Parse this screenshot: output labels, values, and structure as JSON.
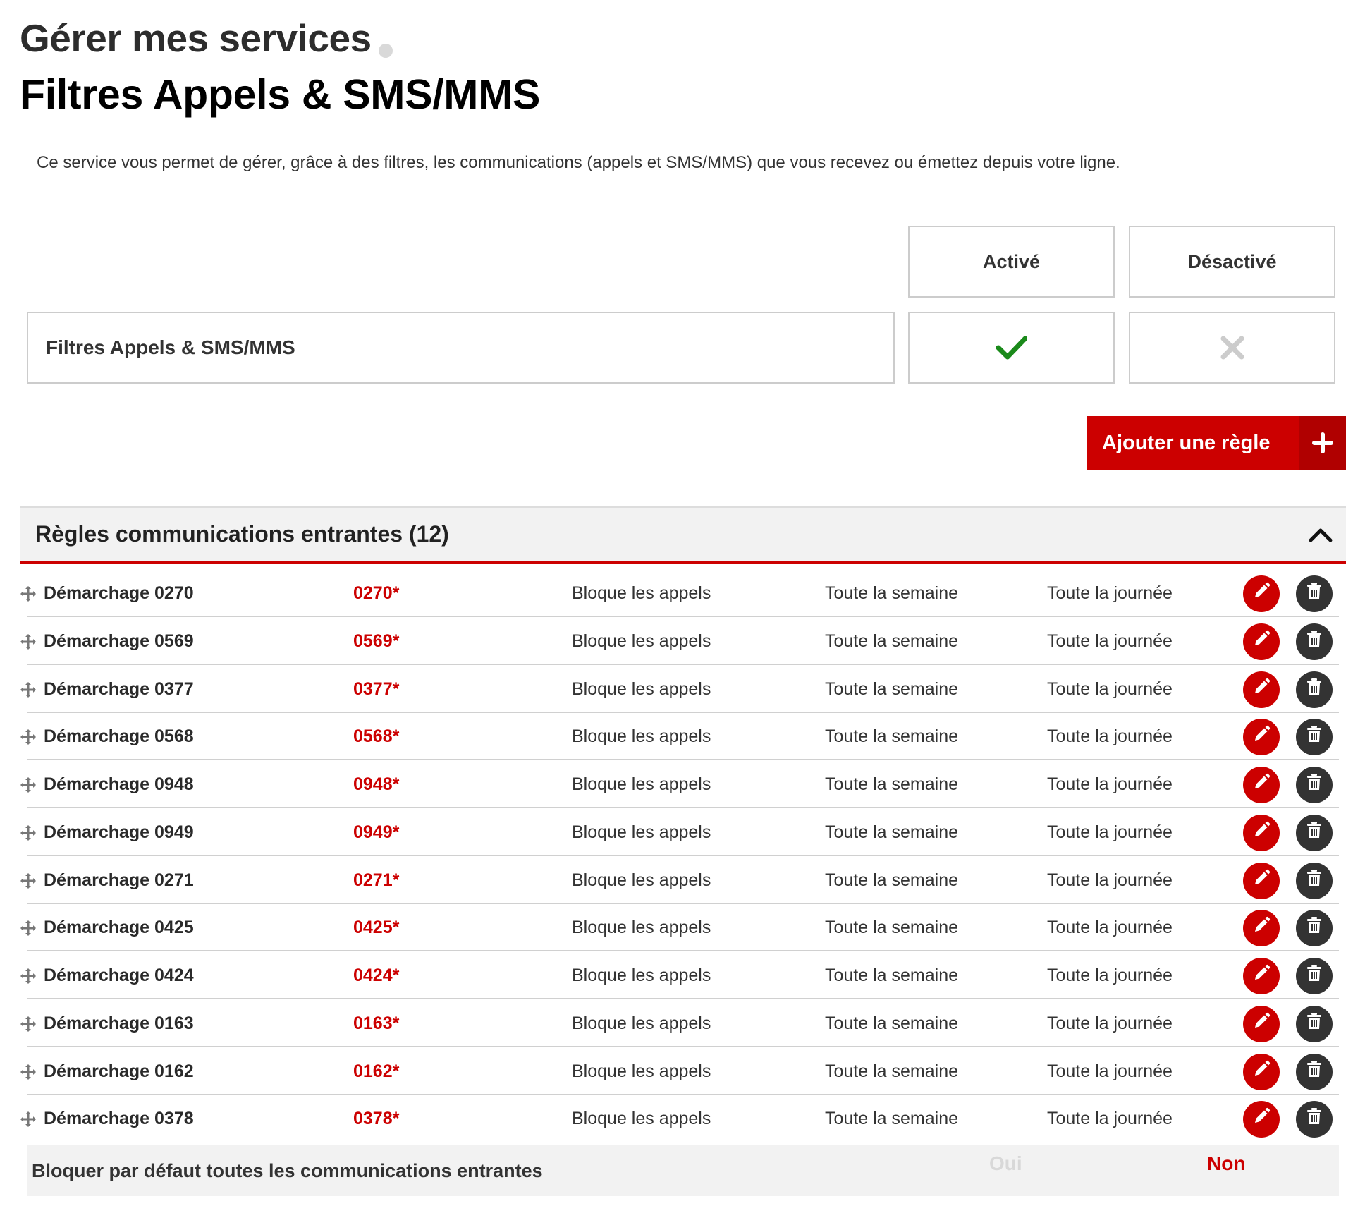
{
  "page": {
    "title": "Gérer mes services",
    "subtitle": "Filtres Appels & SMS/MMS",
    "description": "Ce service vous permet de gérer, grâce à des filtres, les communications (appels et SMS/MMS) que vous recevez ou émettez depuis votre ligne."
  },
  "status_table": {
    "col_active": "Activé",
    "col_inactive": "Désactivé",
    "service_name": "Filtres Appels & SMS/MMS",
    "active_state": "check-icon",
    "inactive_state": "cross-icon"
  },
  "add_rule": {
    "label": "Ajouter une règle"
  },
  "incoming": {
    "title": "Règles communications entrantes (12)",
    "rules": [
      {
        "name": "Démarchage 0270",
        "number": "0270*",
        "action": "Bloque les appels",
        "days": "Toute la semaine",
        "time": "Toute la journée"
      },
      {
        "name": "Démarchage 0569",
        "number": "0569*",
        "action": "Bloque les appels",
        "days": "Toute la semaine",
        "time": "Toute la journée"
      },
      {
        "name": "Démarchage 0377",
        "number": "0377*",
        "action": "Bloque les appels",
        "days": "Toute la semaine",
        "time": "Toute la journée"
      },
      {
        "name": "Démarchage 0568",
        "number": "0568*",
        "action": "Bloque les appels",
        "days": "Toute la semaine",
        "time": "Toute la journée"
      },
      {
        "name": "Démarchage 0948",
        "number": "0948*",
        "action": "Bloque les appels",
        "days": "Toute la semaine",
        "time": "Toute la journée"
      },
      {
        "name": "Démarchage 0949",
        "number": "0949*",
        "action": "Bloque les appels",
        "days": "Toute la semaine",
        "time": "Toute la journée"
      },
      {
        "name": "Démarchage 0271",
        "number": "0271*",
        "action": "Bloque les appels",
        "days": "Toute la semaine",
        "time": "Toute la journée"
      },
      {
        "name": "Démarchage 0425",
        "number": "0425*",
        "action": "Bloque les appels",
        "days": "Toute la semaine",
        "time": "Toute la journée"
      },
      {
        "name": "Démarchage 0424",
        "number": "0424*",
        "action": "Bloque les appels",
        "days": "Toute la semaine",
        "time": "Toute la journée"
      },
      {
        "name": "Démarchage 0163",
        "number": "0163*",
        "action": "Bloque les appels",
        "days": "Toute la semaine",
        "time": "Toute la journée"
      },
      {
        "name": "Démarchage 0162",
        "number": "0162*",
        "action": "Bloque les appels",
        "days": "Toute la semaine",
        "time": "Toute la journée"
      },
      {
        "name": "Démarchage 0378",
        "number": "0378*",
        "action": "Bloque les appels",
        "days": "Toute la semaine",
        "time": "Toute la journée"
      }
    ]
  },
  "default_block": {
    "label": "Bloquer par défaut toutes les communications entrantes",
    "yes": "Oui",
    "no": "Non",
    "selected": "Non"
  },
  "colors": {
    "accent": "#cc0000",
    "check": "#1a8a1a",
    "cross": "#cccccc",
    "dark_button": "#333333"
  }
}
